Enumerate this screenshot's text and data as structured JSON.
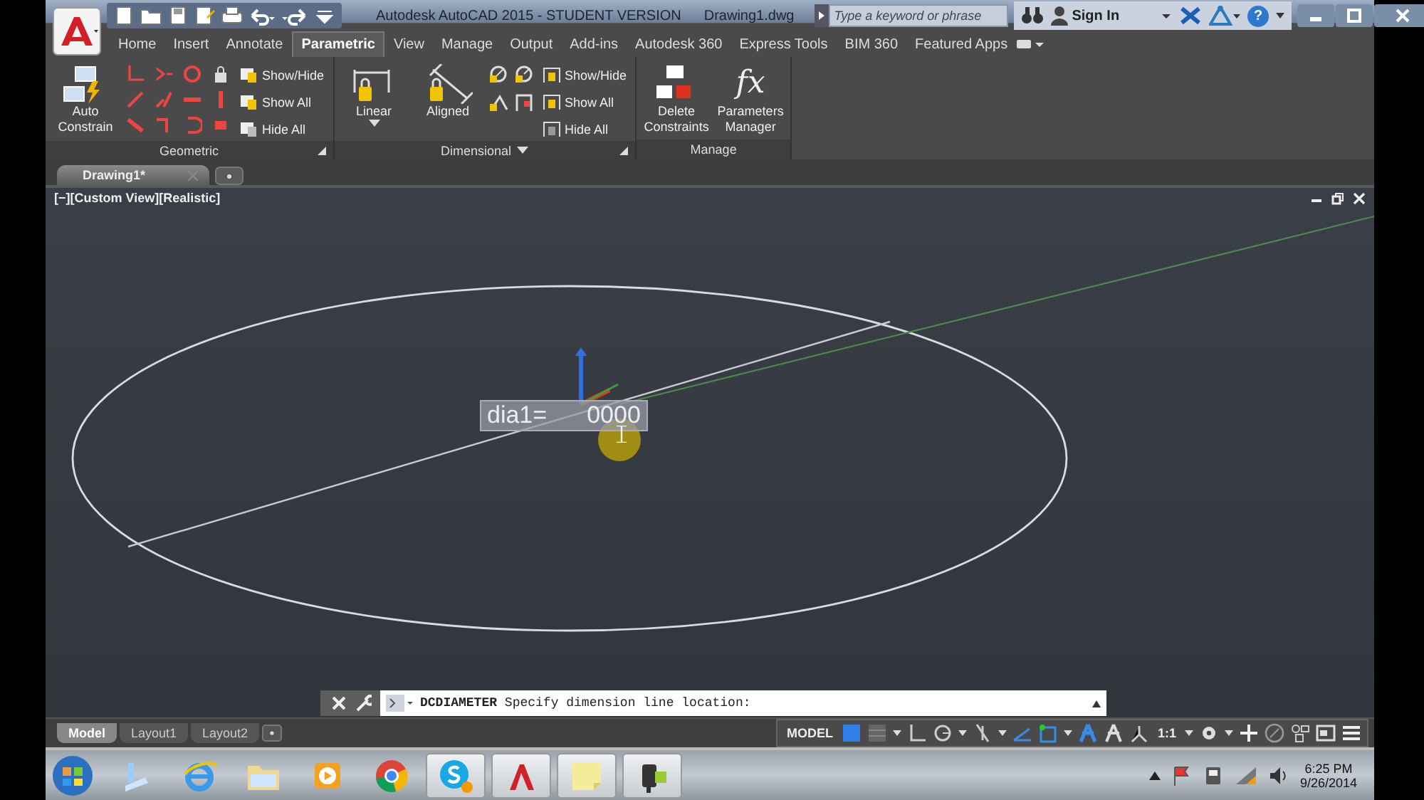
{
  "window": {
    "title": "Autodesk AutoCAD 2015 - STUDENT VERSION",
    "document": "Drawing1.dwg",
    "search": {
      "placeholder": "Type a keyword or phrase"
    },
    "sign_in": "Sign In",
    "help": "?"
  },
  "ribbon_tabs": [
    {
      "label": "Home",
      "selected": false
    },
    {
      "label": "Insert",
      "selected": false
    },
    {
      "label": "Annotate",
      "selected": false
    },
    {
      "label": "Parametric",
      "selected": true
    },
    {
      "label": "View",
      "selected": false
    },
    {
      "label": "Manage",
      "selected": false
    },
    {
      "label": "Output",
      "selected": false
    },
    {
      "label": "Add-ins",
      "selected": false
    },
    {
      "label": "Autodesk 360",
      "selected": false
    },
    {
      "label": "Express Tools",
      "selected": false
    },
    {
      "label": "BIM 360",
      "selected": false
    },
    {
      "label": "Featured Apps",
      "selected": false
    }
  ],
  "ribbon_panels": [
    {
      "title": "Geometric",
      "title_dropdown": false,
      "launcher": true,
      "tools": [
        {
          "kind": "large",
          "label": "Auto Constrain",
          "dropdown": false
        },
        {
          "kind": "grid"
        },
        {
          "kind": "list",
          "items": [
            "Show/Hide",
            "Show All",
            "Hide All"
          ]
        }
      ]
    },
    {
      "title": "Dimensional",
      "title_dropdown": true,
      "launcher": true,
      "tools": [
        {
          "kind": "large",
          "label": "Linear",
          "dropdown": true
        },
        {
          "kind": "large",
          "label": "Aligned",
          "dropdown": false
        },
        {
          "kind": "grid_small"
        },
        {
          "kind": "list",
          "items": [
            "Show/Hide",
            "Show All",
            "Hide All"
          ]
        }
      ]
    },
    {
      "title": "Manage",
      "title_dropdown": false,
      "launcher": false,
      "tools": [
        {
          "kind": "large",
          "label": "Delete Constraints",
          "dropdown": false
        },
        {
          "kind": "large",
          "glyph": "fx",
          "label": "Parameters Manager",
          "dropdown": false
        }
      ]
    }
  ],
  "file_tabs": [
    {
      "label": "Drawing1*",
      "selected": true
    }
  ],
  "viewport": {
    "label": "[−][Custom View][Realistic]",
    "dimension_input": {
      "label": "dia1=",
      "value": "0000"
    }
  },
  "command_line": {
    "text": "**DCDIAMETER** Specify dimension line location:"
  },
  "layout_tabs": [
    {
      "label": "Model",
      "selected": true
    },
    {
      "label": "Layout1",
      "selected": false
    },
    {
      "label": "Layout2",
      "selected": false
    }
  ],
  "status_bar": {
    "space": "MODEL",
    "scale": "1:1"
  },
  "taskbar": {
    "apps": [
      {
        "kind": "explorer-drive",
        "running": false
      },
      {
        "kind": "ie",
        "running": false
      },
      {
        "kind": "folder",
        "running": false
      },
      {
        "kind": "media",
        "running": false
      },
      {
        "kind": "chrome",
        "running": false
      },
      {
        "kind": "skype",
        "running": true
      },
      {
        "kind": "autocad",
        "running": true
      },
      {
        "kind": "notes",
        "running": true
      },
      {
        "kind": "camera",
        "running": true
      }
    ],
    "time": "6:25 PM",
    "date": "9/26/2014"
  }
}
